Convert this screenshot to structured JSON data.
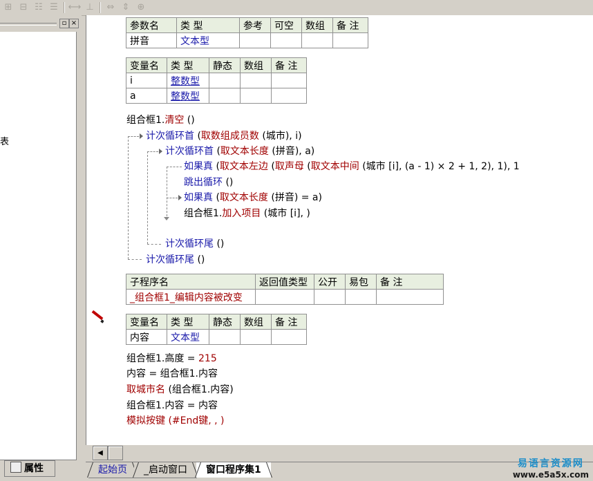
{
  "toolbar": {
    "icons": [
      "insert-row-icon",
      "insert-col-icon",
      "delete-row-icon",
      "delete-col-icon",
      "distribute-h-icon",
      "distribute-v-icon",
      "fit-width-icon",
      "fit-height-icon",
      "fit-both-icon"
    ]
  },
  "left_panel": {
    "fragment_text": "表",
    "property_tab": "属性"
  },
  "tables": {
    "params": {
      "headers": [
        "参数名",
        "类 型",
        "参考",
        "可空",
        "数组",
        "备 注"
      ],
      "rows": [
        [
          "拼音",
          "文本型",
          "",
          "",
          "",
          ""
        ]
      ]
    },
    "vars1": {
      "headers": [
        "变量名",
        "类 型",
        "静态",
        "数组",
        "备 注"
      ],
      "rows": [
        [
          "i",
          "整数型",
          "",
          "",
          ""
        ],
        [
          "a",
          "整数型",
          "",
          "",
          ""
        ]
      ]
    },
    "subroutine": {
      "headers": [
        "子程序名",
        "返回值类型",
        "公开",
        "易包",
        "备 注"
      ],
      "rows": [
        [
          "_组合框1_编辑内容被改变",
          "",
          "",
          "",
          ""
        ]
      ]
    },
    "vars2": {
      "headers": [
        "变量名",
        "类 型",
        "静态",
        "数组",
        "备 注"
      ],
      "rows": [
        [
          "内容",
          "文本型",
          "",
          "",
          ""
        ]
      ]
    }
  },
  "code": {
    "l1_obj": "组合框1.",
    "l1_method": "清空",
    "l1_args": " ()",
    "l2_kw": "计次循环首",
    "l2_a": " (",
    "l2_fn": "取数组成员数",
    "l2_b": " (城市), i)",
    "l3_kw": "计次循环首",
    "l3_a": " (",
    "l3_fn": "取文本长度",
    "l3_b": " (拼音), a)",
    "l4_kw": "如果真",
    "l4_a": " (",
    "l4_fn1": "取文本左边",
    "l4_b": " (",
    "l4_fn2": "取声母",
    "l4_c": " (",
    "l4_fn3": "取文本中间",
    "l4_d": " (城市 [i], (a - 1) × 2 + 1, 2), 1), 1",
    "l5_kw": "跳出循环",
    "l5_a": " ()",
    "l6_kw": "如果真",
    "l6_a": " (",
    "l6_fn": "取文本长度",
    "l6_b": " (拼音) = a)",
    "l7_obj": "组合框1.",
    "l7_method": "加入项目",
    "l7_args": " (城市 [i], )",
    "l8_kw": "计次循环尾",
    "l8_a": " ()",
    "l9_kw": "计次循环尾",
    "l9_a": " ()",
    "m1_a": "组合框1.高度 = ",
    "m1_num": "215",
    "m2": "内容 = 组合框1.内容",
    "m3_fn": "取城市名",
    "m3_a": " (组合框1.内容)",
    "m4": "组合框1.内容 = 内容",
    "m5_fn": "模拟按键",
    "m5_a": " (#End键, , )"
  },
  "tabs": {
    "tab1": "起始页",
    "tab2": "_启动窗口",
    "tab3": "窗口程序集1"
  },
  "watermark": {
    "line1": "易语言资源网",
    "line2": "www.e5a5x.com"
  },
  "colors": {
    "keyword": "#1a1aaa",
    "function": "#a00000",
    "header_bg": "#e8efe0",
    "watermark": "#1e8ec9"
  }
}
